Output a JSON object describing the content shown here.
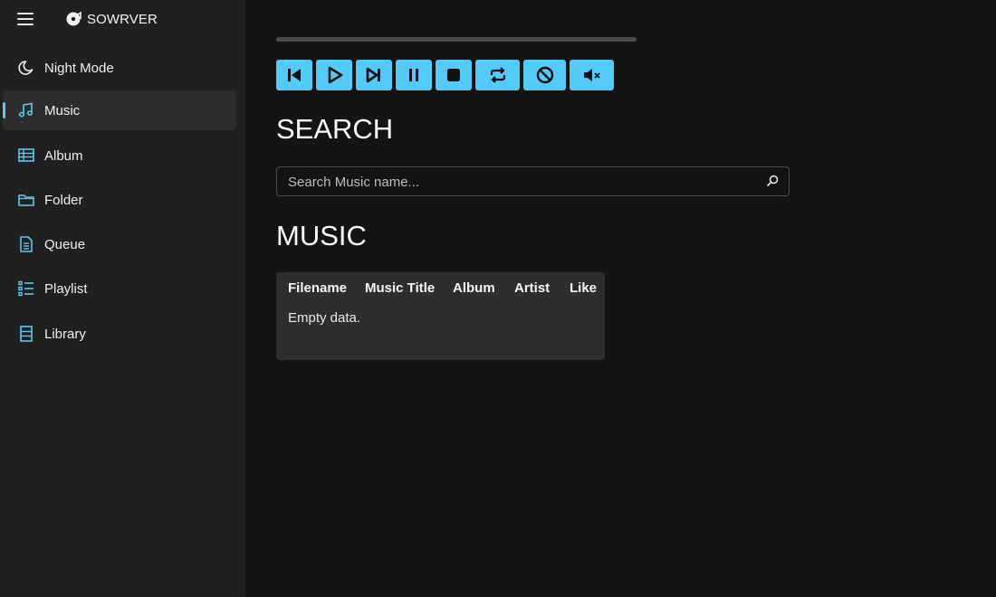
{
  "app": {
    "brand": "SOWRVER"
  },
  "sidebar": {
    "items": [
      {
        "label": "Night Mode",
        "icon": "moon-icon"
      },
      {
        "label": "Music",
        "icon": "music-note-icon",
        "active": true
      },
      {
        "label": "Album",
        "icon": "album-grid-icon"
      },
      {
        "label": "Folder",
        "icon": "folder-icon"
      },
      {
        "label": "Queue",
        "icon": "document-icon"
      },
      {
        "label": "Playlist",
        "icon": "playlist-icon"
      },
      {
        "label": "Library",
        "icon": "library-icon"
      }
    ]
  },
  "player": {
    "progress": 0,
    "controls": [
      {
        "name": "previous",
        "icon": "skip-previous-icon"
      },
      {
        "name": "play",
        "icon": "play-icon"
      },
      {
        "name": "next",
        "icon": "skip-next-icon"
      },
      {
        "name": "pause",
        "icon": "pause-icon"
      },
      {
        "name": "stop",
        "icon": "stop-icon"
      },
      {
        "name": "repeat",
        "icon": "repeat-icon"
      },
      {
        "name": "block",
        "icon": "block-icon"
      },
      {
        "name": "mute",
        "icon": "mute-icon"
      }
    ]
  },
  "search": {
    "heading": "SEARCH",
    "placeholder": "Search Music name...",
    "value": ""
  },
  "music": {
    "heading": "MUSIC",
    "columns": [
      "Filename",
      "Music Title",
      "Album",
      "Artist",
      "Like"
    ],
    "empty_text": "Empty data."
  },
  "colors": {
    "accent": "#5cc8f5",
    "sidebar_bg": "#202020",
    "main_bg": "#141414",
    "card_bg": "#2e2e2e"
  }
}
